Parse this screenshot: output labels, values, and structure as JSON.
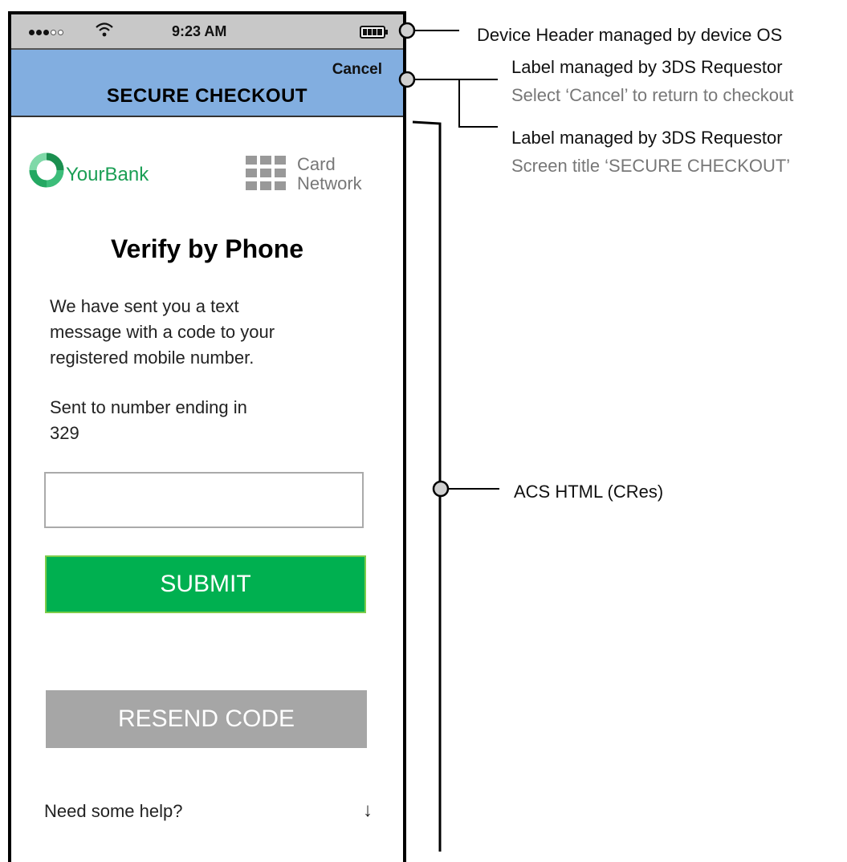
{
  "status_bar": {
    "time": "9:23 AM",
    "signal_icon": "signal-dots-icon",
    "wifi_icon": "wifi-icon",
    "battery_icon": "battery-icon"
  },
  "header": {
    "cancel_label": "Cancel",
    "title": "SECURE CHECKOUT",
    "background_color": "#82aee0"
  },
  "logos": {
    "bank_name": "YourBank",
    "bank_icon": "bank-ring-logo-icon",
    "card_network_line1": "Card",
    "card_network_line2": "Network",
    "card_network_icon": "grid-icon"
  },
  "content": {
    "title": "Verify by Phone",
    "message_lines": [
      "We have sent you a text",
      "message with a code to your",
      "registered mobile number."
    ],
    "sent_to_lines": [
      "Sent to number ending in",
      "329"
    ],
    "code_input_value": "",
    "submit_label": "SUBMIT",
    "submit_color": "#00b050",
    "resend_label": "RESEND CODE",
    "resend_color": "#a6a6a6",
    "help_label": "Need some help?",
    "help_arrow": "↓"
  },
  "annotations": {
    "device_header": "Device Header managed by device OS",
    "cancel_label_title": "Label managed by 3DS Requestor",
    "cancel_label_desc": "Select ‘Cancel’ to return to checkout",
    "title_label_title": "Label managed by 3DS Requestor",
    "title_label_desc": "Screen title ‘SECURE CHECKOUT’",
    "acs_html": "ACS HTML (CRes)"
  }
}
